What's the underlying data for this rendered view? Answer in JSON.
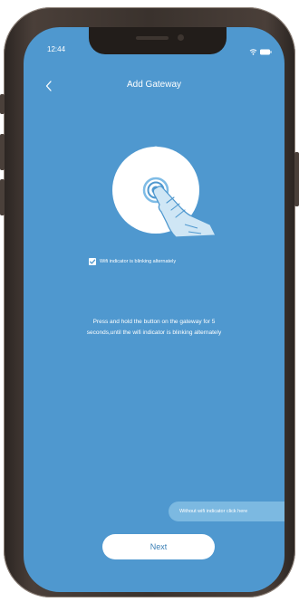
{
  "status_bar": {
    "time": "12:44",
    "icons": [
      "wifi-icon",
      "battery-icon"
    ]
  },
  "header": {
    "back_icon": "chevron-left-icon",
    "title": "Add Gateway"
  },
  "illustration": {
    "icon": "gateway-press-button-icon"
  },
  "confirm": {
    "checked": true,
    "label": "Wifi indicator is blinking alternately"
  },
  "instructions": {
    "line1": "Press and hold the button on the gateway for 5",
    "line2": "seconds,until the wifi indicator is blinking alternately"
  },
  "alt_link": {
    "label": "Without wifi indicator click here"
  },
  "actions": {
    "next_label": "Next"
  },
  "colors": {
    "screen_bg": "#4f98cf",
    "accent": "#3a7fb5",
    "pill_bg": "#7cb9e1"
  }
}
